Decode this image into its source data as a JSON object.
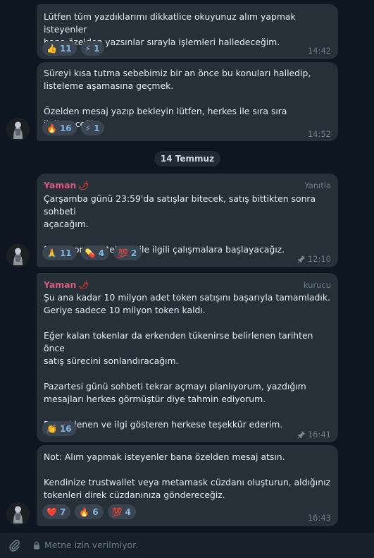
{
  "messages": [
    {
      "text": "Lütfen tüm yazdıklarımı dikkatlice okuyunuz alım yapmak isteyenler\nbana özelden yazsınlar sırayla işlemleri halledeceğim.",
      "reactions": [
        {
          "emoji": "👍",
          "count": "11"
        },
        {
          "emoji": "⚡",
          "count": "1"
        }
      ],
      "time": "14:42"
    },
    {
      "text": "Süreyi kısa tutma sebebimiz bir an önce bu konuları halledip,\nlisteleme aşamasına geçmek.\n\nÖzelden mesaj yazıp bekleyin lütfen, herkes ile sıra sıra ilgileneceğim.",
      "reactions": [
        {
          "emoji": "🔥",
          "count": "16"
        },
        {
          "emoji": "⚡",
          "count": "1"
        }
      ],
      "time": "14:52"
    },
    {
      "sender": "Yaman",
      "badge": "🌶",
      "role": "Yanıtla",
      "text": "Çarşamba günü 23:59'da satışlar bitecek, satış bittikten sonra sohbeti\naçacağım.\n\nDaha sonra listeleme ile ilgili çalışmalara başlayacağız.",
      "reactions": [
        {
          "emoji": "🙏",
          "count": "11"
        },
        {
          "emoji": "💊",
          "count": "4"
        },
        {
          "emoji": "💯",
          "count": "2"
        }
      ],
      "time": "12:10"
    },
    {
      "sender": "Yaman",
      "badge": "🌶",
      "role": "kurucu",
      "text": "Şu ana kadar 10 milyon adet token satışını başarıyla tamamladık.\nGeriye sadece 10 milyon token kaldı.\n\nEğer kalan tokenlar da erkenden tükenirse belirlenen tarihten önce\nsatış sürecini sonlandıracağım.\n\nPazartesi günü sohbeti tekrar açmayı planlıyorum, yazdığım\nmesajları herkes görmüştür diye tahmin ediyorum.\n\nDesteklenen ve ilgi gösteren herkese teşekkür ederim.",
      "reactions": [
        {
          "emoji": "👏",
          "count": "16"
        }
      ],
      "time": "16:41"
    },
    {
      "text": "Not: Alım yapmak isteyenler bana özelden mesaj atsın.\n\nKendinize trustwallet veya metamask cüzdanı oluşturun, aldığınız\ntokenleri direk cüzdanınıza göndereceğiz.",
      "reactions": [
        {
          "emoji": "❤️",
          "count": "7"
        },
        {
          "emoji": "🔥",
          "count": "6"
        },
        {
          "emoji": "💯",
          "count": "4"
        }
      ],
      "time": "16:43"
    }
  ],
  "date_separator": "14 Temmuz",
  "composer": {
    "placeholder": "Metne izin verilmiyor."
  },
  "colors": {
    "background": "#0e1621",
    "bubble": "#263039",
    "sender": "#e0587e",
    "accent": "#7fb6e0"
  },
  "icons": {
    "attach": "paperclip-icon",
    "lock": "lock-icon",
    "pin": "pin-icon"
  }
}
